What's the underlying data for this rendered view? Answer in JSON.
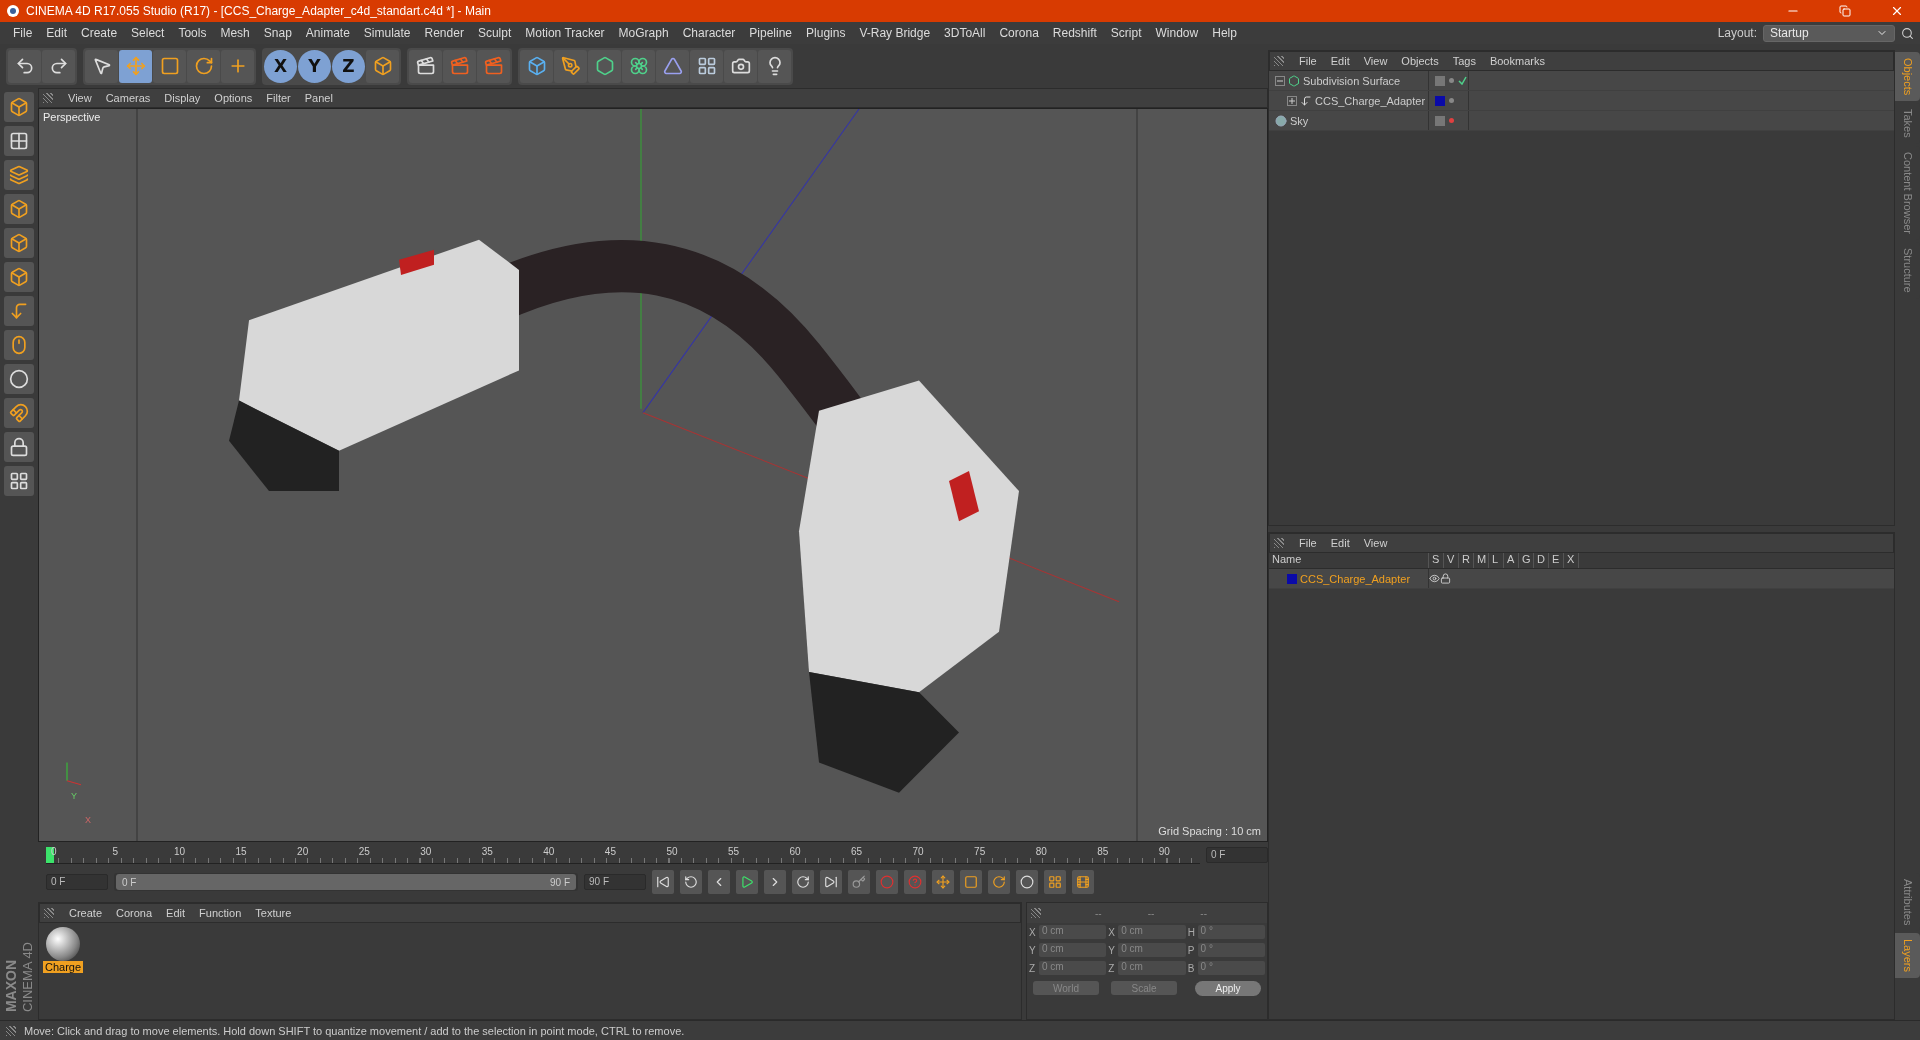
{
  "window": {
    "title": "CINEMA 4D R17.055 Studio (R17) - [CCS_Charge_Adapter_c4d_standart.c4d *] - Main"
  },
  "menu": [
    "File",
    "Edit",
    "Create",
    "Select",
    "Tools",
    "Mesh",
    "Snap",
    "Animate",
    "Simulate",
    "Render",
    "Sculpt",
    "Motion Tracker",
    "MoGraph",
    "Character",
    "Pipeline",
    "Plugins",
    "V-Ray Bridge",
    "3DToAll",
    "Corona",
    "Redshift",
    "Script",
    "Window",
    "Help"
  ],
  "layout": {
    "label": "Layout:",
    "value": "Startup"
  },
  "axis_buttons": [
    {
      "label": "X",
      "selected": true
    },
    {
      "label": "Y",
      "selected": true
    },
    {
      "label": "Z",
      "selected": true
    }
  ],
  "viewport": {
    "menu": [
      "View",
      "Cameras",
      "Display",
      "Options",
      "Filter",
      "Panel"
    ],
    "camera": "Perspective",
    "grid_spacing": "Grid Spacing : 10 cm",
    "gizmo": [
      "Y",
      "X"
    ]
  },
  "timeline": {
    "ticks": [
      "0",
      "5",
      "10",
      "15",
      "20",
      "25",
      "30",
      "35",
      "40",
      "45",
      "50",
      "55",
      "60",
      "65",
      "70",
      "75",
      "80",
      "85",
      "90"
    ],
    "current": "0 F",
    "playhead": {
      "level": 0
    },
    "start": "0 F",
    "range": {
      "level": 1
    },
    "range_start": "0 F",
    "range_end": "90 F",
    "end": "90 F"
  },
  "materials": {
    "menu": [
      "Create",
      "Corona",
      "Edit",
      "Function",
      "Texture"
    ],
    "items": [
      {
        "name": "Charge",
        "selected": true
      }
    ]
  },
  "coordinates": {
    "headers": [
      "--",
      "--",
      "--"
    ],
    "rows": [
      {
        "a1": "X",
        "v1": "0 cm",
        "a2": "X",
        "v2": "0 cm",
        "a3": "H",
        "v3": "0 °"
      },
      {
        "a1": "Y",
        "v1": "0 cm",
        "a2": "Y",
        "v2": "0 cm",
        "a3": "P",
        "v3": "0 °"
      },
      {
        "a1": "Z",
        "v1": "0 cm",
        "a2": "Z",
        "v2": "0 cm",
        "a3": "B",
        "v3": "0 °"
      }
    ],
    "mode": "World",
    "transform": "Scale",
    "apply": "Apply"
  },
  "branding": {
    "company": "MAXON",
    "product": "CINEMA 4D"
  },
  "objects": {
    "menu": [
      "File",
      "Edit",
      "View",
      "Objects",
      "Tags",
      "Bookmarks"
    ],
    "tree": [
      {
        "name": "Subdivision Surface",
        "kind": "generator",
        "expanded": true,
        "checked": true,
        "render_off": false,
        "children": [
          {
            "name": "CCS_Charge_Adapter",
            "kind": "null",
            "expanded": false,
            "checked": false,
            "render_off": false,
            "color": "#0a0aa8"
          }
        ]
      },
      {
        "name": "Sky",
        "kind": "sky",
        "checked": false,
        "render_off": true
      }
    ]
  },
  "layers": {
    "menu": [
      "File",
      "Edit",
      "View"
    ],
    "columns": [
      "Name",
      "S",
      "V",
      "R",
      "M",
      "L",
      "A",
      "G",
      "D",
      "E",
      "X"
    ],
    "items": [
      {
        "name": "CCS_Charge_Adapter",
        "color": "#0a0aa8"
      }
    ]
  },
  "side_tabs_top": [
    {
      "label": "Objects",
      "selected": true
    },
    {
      "label": "Takes",
      "selected": false
    },
    {
      "label": "Content Browser",
      "selected": false
    },
    {
      "label": "Structure",
      "selected": false
    }
  ],
  "side_tabs_bottom": [
    {
      "label": "Attributes",
      "selected": false
    },
    {
      "label": "Layers",
      "selected": true
    }
  ],
  "status_bar": "Move: Click and drag to move elements. Hold down SHIFT to quantize movement / add to the selection in point mode, CTRL to remove."
}
